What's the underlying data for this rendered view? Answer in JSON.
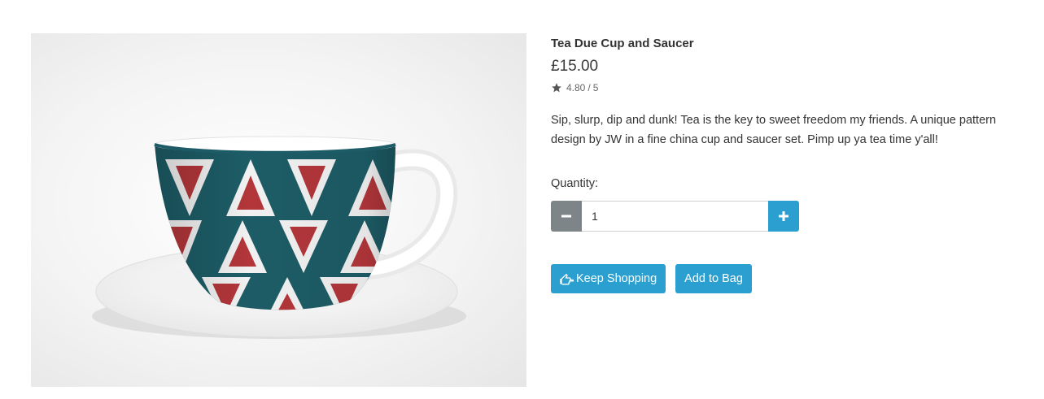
{
  "product": {
    "title": "Tea Due Cup and Saucer",
    "price": "£15.00",
    "rating": {
      "score": "4.80",
      "max": "5",
      "icon": "star-icon"
    },
    "description": "Sip, slurp, dip and dunk! Tea is the key to sweet freedom my friends. A unique pattern design by JW in a fine china cup and saucer set. Pimp up ya tea time y'all!",
    "image": {
      "subject": "product-photo-cup-and-saucer"
    }
  },
  "quantity": {
    "label": "Quantity:",
    "value": "1",
    "decrement_icon": "minus-icon",
    "increment_icon": "plus-icon"
  },
  "actions": {
    "keep_shopping": "Keep Shopping",
    "keep_shopping_icon": "hand-left-icon",
    "add_to_bag": "Add to Bag"
  },
  "colors": {
    "accent": "#2a9fd0",
    "decrement_bg": "#7d8589",
    "pattern_teal": "#1d5c66",
    "pattern_red": "#b2363a"
  }
}
